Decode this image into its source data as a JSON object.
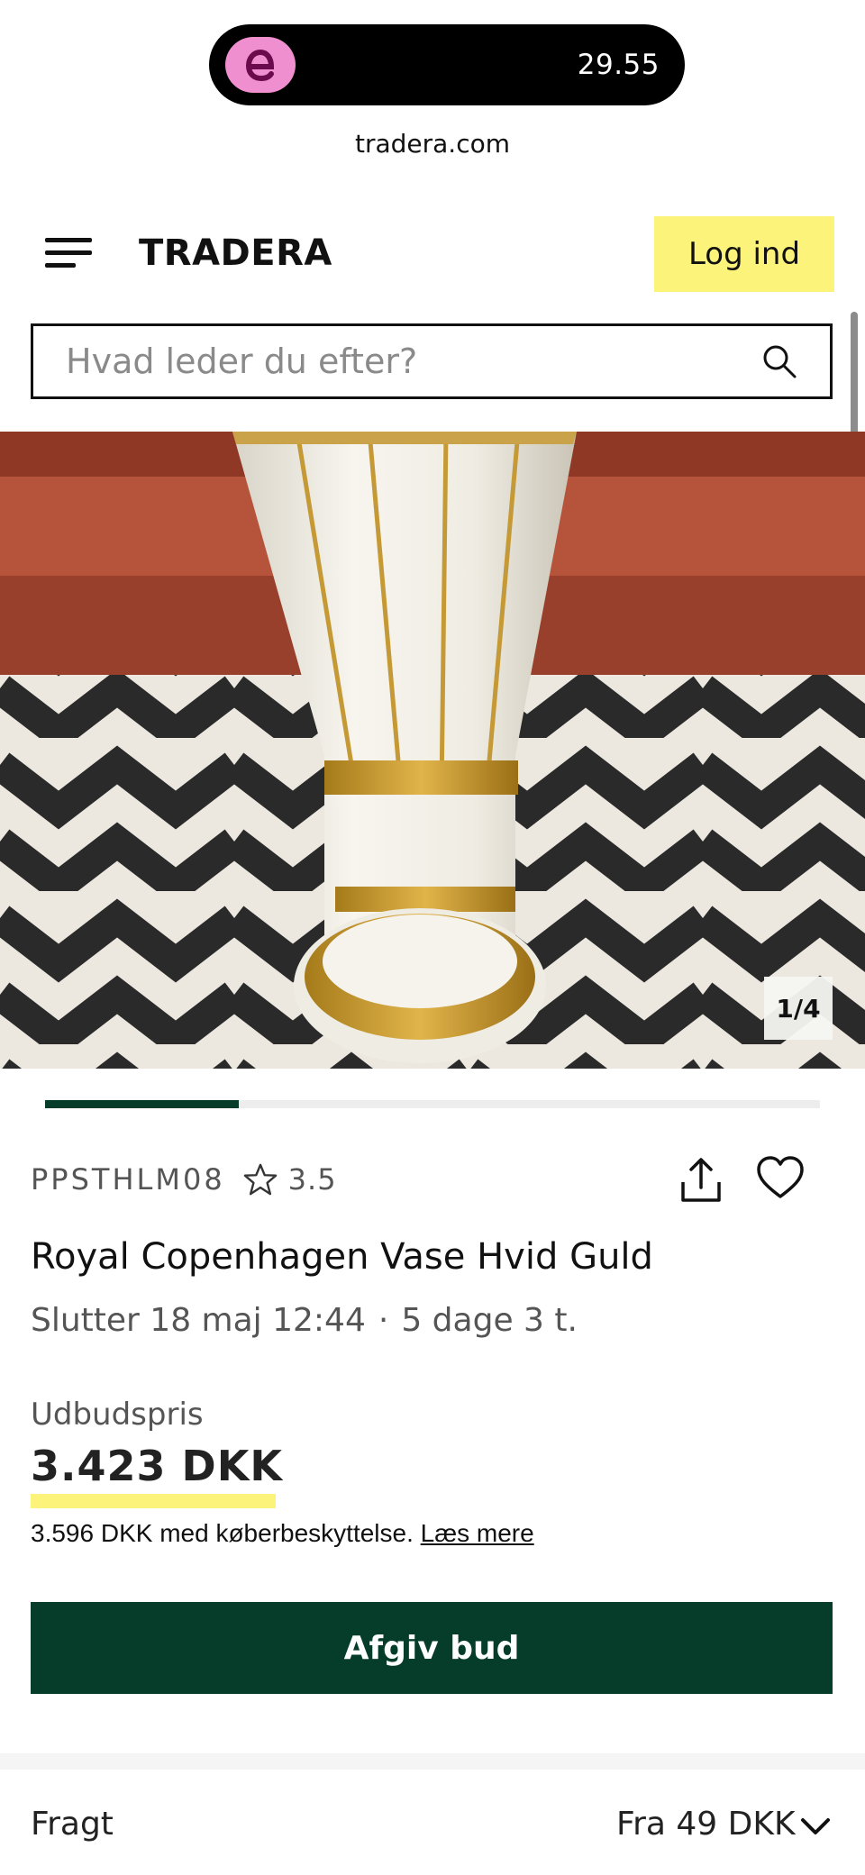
{
  "status_bar": {
    "app_icon": "e-app-icon",
    "time": "29.55"
  },
  "browser": {
    "url": "tradera.com"
  },
  "header": {
    "menu_icon": "hamburger-menu-icon",
    "brand": "TRADERA",
    "login_label": "Log ind"
  },
  "search": {
    "placeholder": "Hvad leder du efter?",
    "icon": "search-icon"
  },
  "gallery": {
    "counter": "1/4",
    "current": 1,
    "total": 4,
    "progress_fraction": 0.25
  },
  "listing": {
    "seller": "PPSTHLM08",
    "rating": "3.5",
    "title": "Royal Copenhagen Vase Hvid Guld",
    "end_date": "Slutter 18 maj 12:44",
    "end_separator": "·",
    "time_left": "5 dage 3 t.",
    "price_label": "Udbudspris",
    "price": "3.423 DKK",
    "protection_text": "3.596 DKK med køberbeskyttelse.",
    "read_more": "Læs mere",
    "bid_label": "Afgiv bud"
  },
  "shipping": {
    "label": "Fragt",
    "value": "Fra 49 DKK"
  },
  "colors": {
    "accent_yellow": "#fcf37a",
    "brand_green": "#063c2a",
    "status_pill": "#000000",
    "app_icon_pink": "#f08fcf"
  }
}
